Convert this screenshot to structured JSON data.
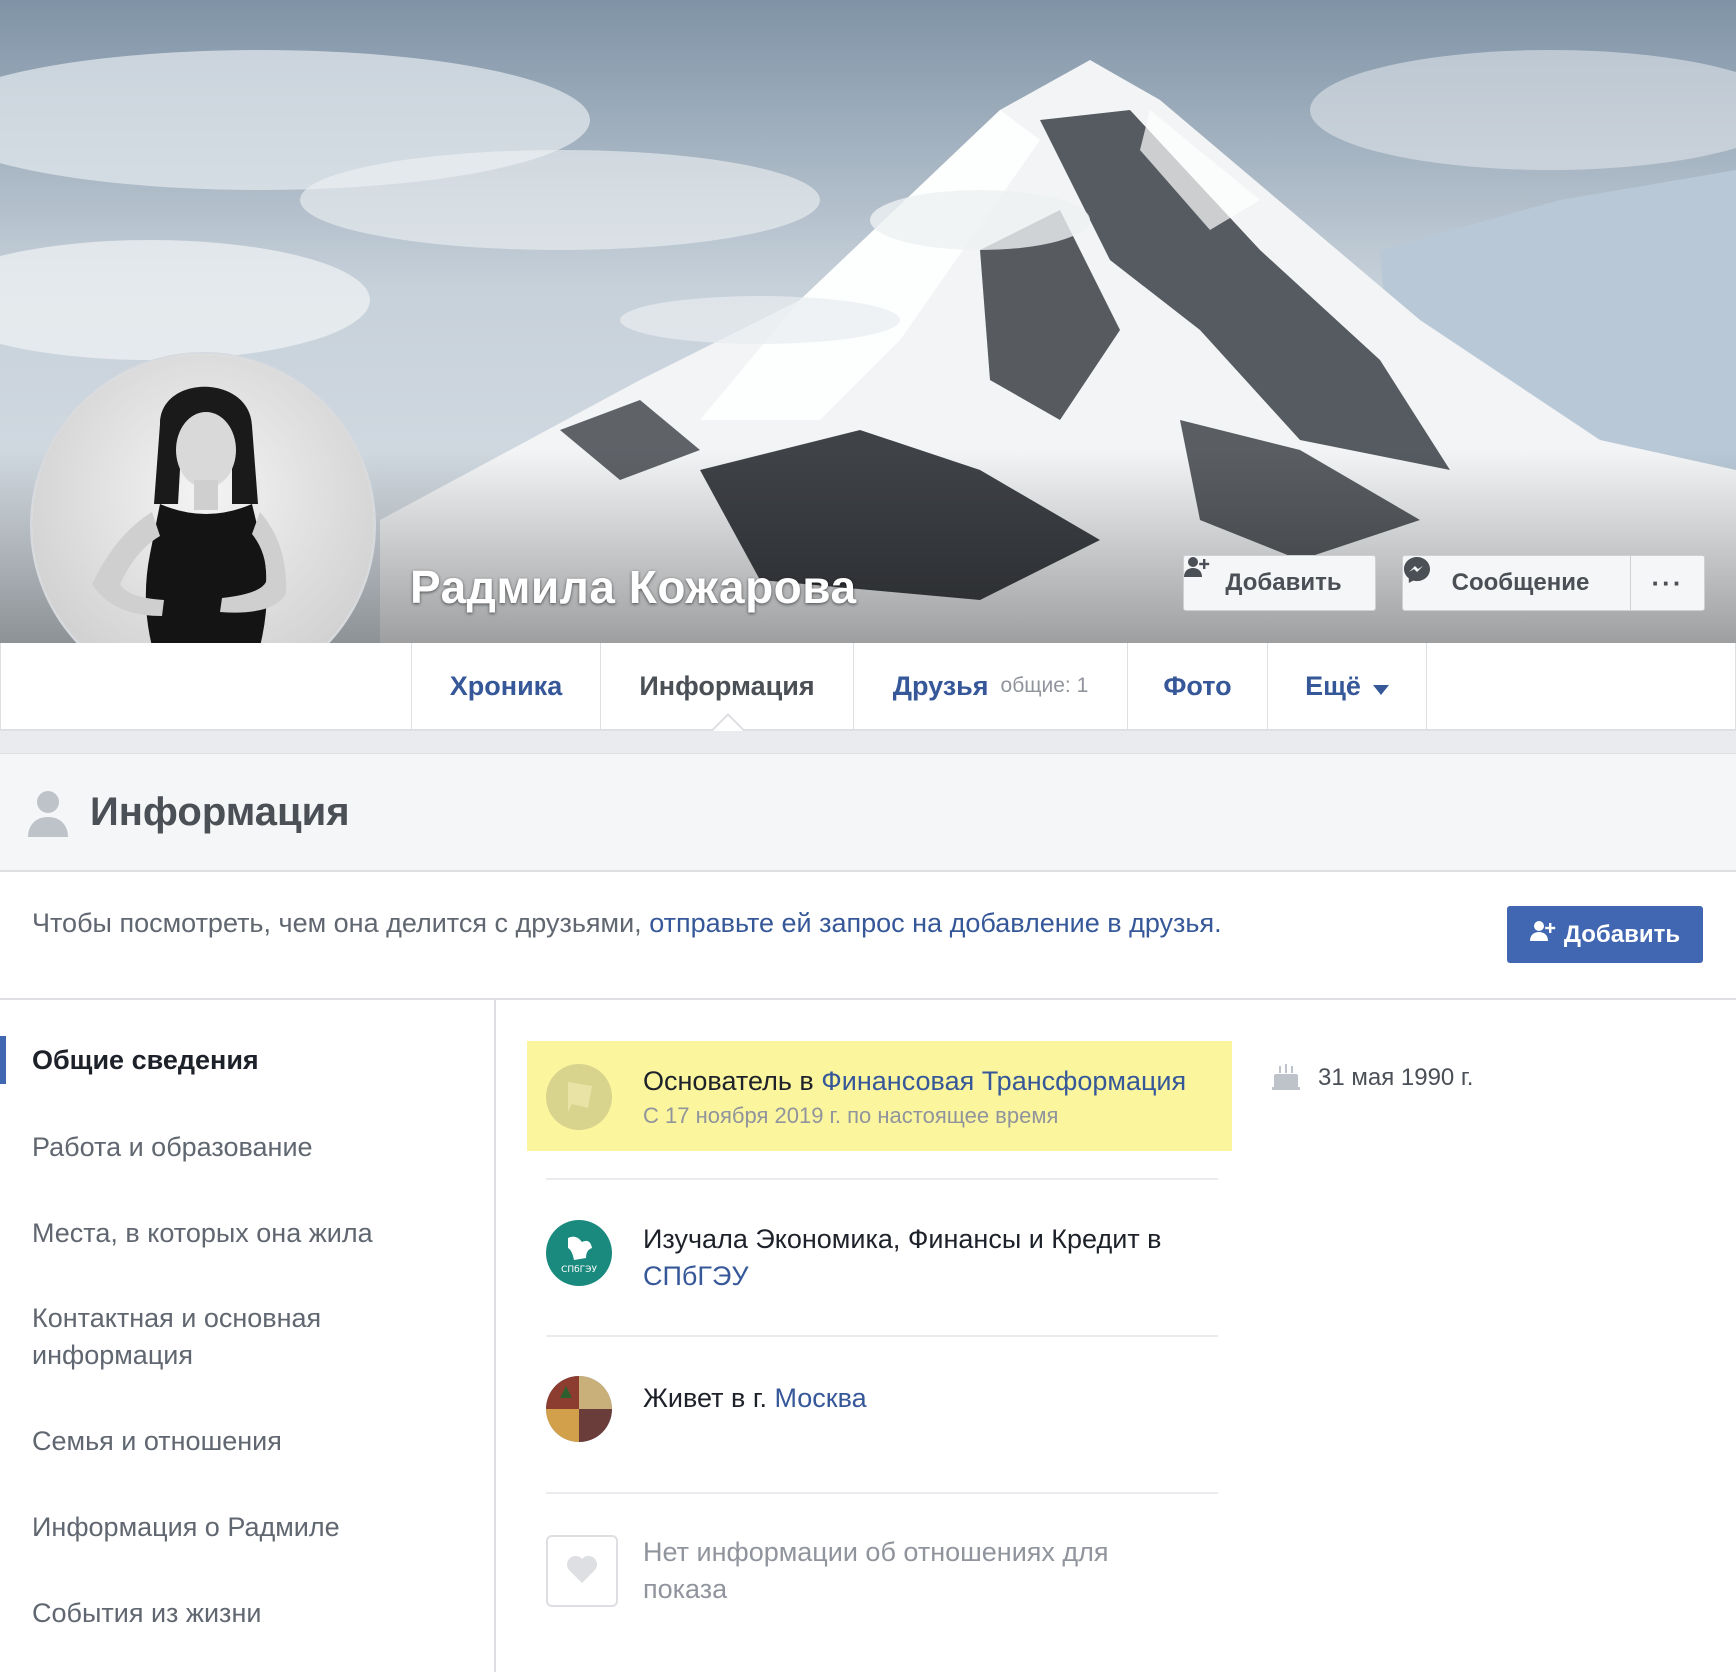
{
  "profile": {
    "name": "Радмила Кожарова"
  },
  "cover_actions": {
    "add_label": "Добавить",
    "message_label": "Сообщение",
    "more_label": "···"
  },
  "tabs": [
    {
      "label": "Хроника"
    },
    {
      "label": "Информация"
    },
    {
      "label": "Друзья",
      "sub": "общие: 1"
    },
    {
      "label": "Фото"
    },
    {
      "label": "Ещё"
    }
  ],
  "section": {
    "title": "Информация"
  },
  "request": {
    "text": "Чтобы посмотреть, чем она делится с друзьями,",
    "link": "отправьте ей запрос на добавление в друзья.",
    "button_label": "Добавить"
  },
  "menu": [
    {
      "label": "Общие сведения",
      "active": true
    },
    {
      "label": "Работа и образование"
    },
    {
      "label": "Места, в которых она жила"
    },
    {
      "label": "Контактная и основная информация"
    },
    {
      "label": "Семья и отношения"
    },
    {
      "label": "Информация о Радмиле"
    },
    {
      "label": "События из жизни"
    }
  ],
  "overview": {
    "work": {
      "prefix": "Основатель в",
      "company": "Финансовая Трансформация",
      "period": "С 17 ноября 2019 г. по настоящее время"
    },
    "education": {
      "prefix": "Изучала Экономика, Финансы и Кредит в",
      "school": "СПбГЭУ",
      "logo_text": "СПбГЭУ"
    },
    "location": {
      "prefix": "Живет в г.",
      "city": "Москва"
    },
    "relationship": {
      "text": "Нет информации об отношениях для показа"
    },
    "birthday": "31 мая 1990 г."
  },
  "colors": {
    "link": "#365899",
    "primary_button": "#4267b2",
    "highlight": "#fbf59e",
    "university": "#1b8a7e"
  },
  "icons": [
    "add-friend-icon",
    "messenger-icon",
    "caret-down-icon",
    "person-icon",
    "flag-icon",
    "cake-icon",
    "heart-icon"
  ]
}
